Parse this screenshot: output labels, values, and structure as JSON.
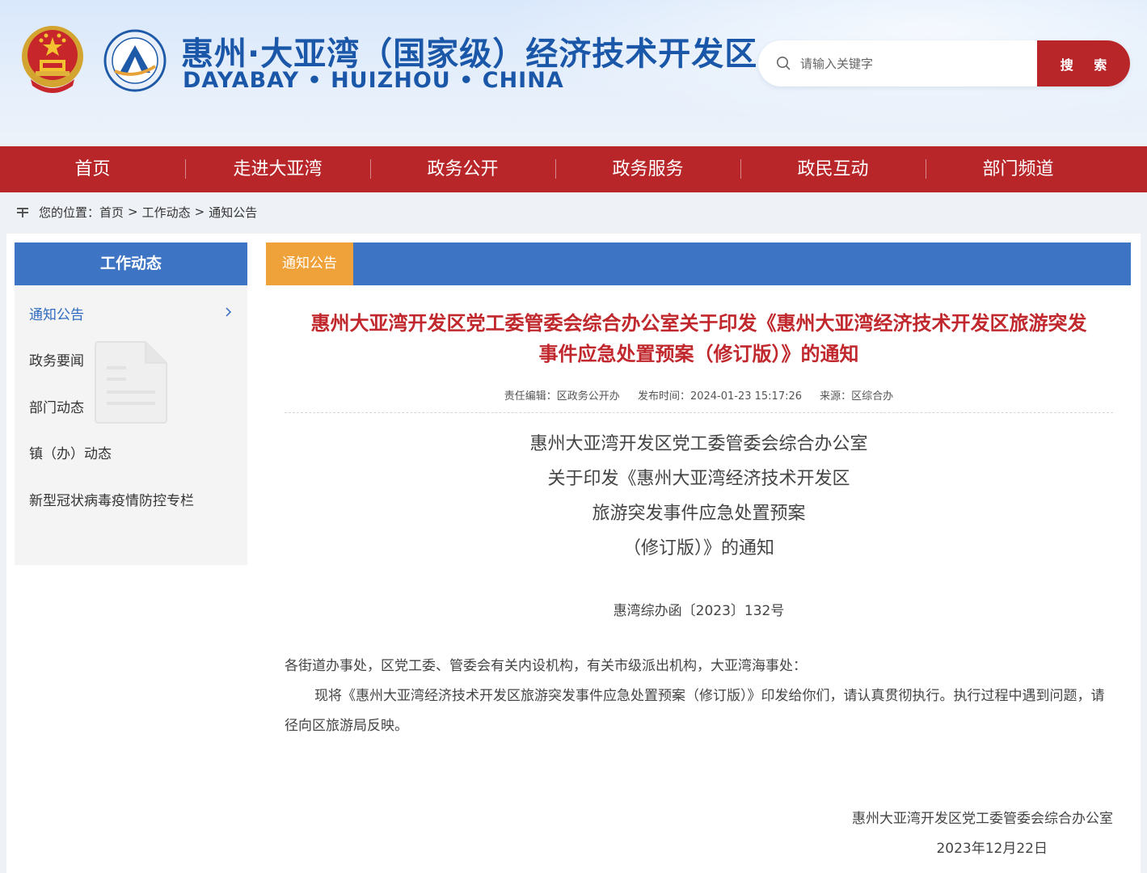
{
  "header": {
    "title_cn": "惠州·大亚湾（国家级）经济技术开发区",
    "title_en": "DAYABAY • HUIZHOU • CHINA",
    "search": {
      "placeholder": "请输入关键字",
      "button": "搜 索"
    }
  },
  "nav": [
    "首页",
    "走进大亚湾",
    "政务公开",
    "政务服务",
    "政民互动",
    "部门频道"
  ],
  "breadcrumb": {
    "prefix": "您的位置：",
    "items": [
      "首页",
      "工作动态",
      "通知公告"
    ],
    "separator": ">"
  },
  "sidebar": {
    "heading": "工作动态",
    "items": [
      "通知公告",
      "政务要闻",
      "部门动态",
      "镇（办）动态",
      "新型冠状病毒疫情防控专栏"
    ]
  },
  "content": {
    "tab": "通知公告",
    "title_line1": "惠州大亚湾开发区党工委管委会综合办公室关于印发《惠州大亚湾经济技术开发区旅游突发",
    "title_line2": "事件应急处置预案（修订版）》的通知",
    "meta": {
      "editor": "责任编辑：区政务公开办",
      "time": "发布时间：2024-01-23 15:17:26",
      "source": "来源：区综合办"
    },
    "doc_heading": [
      "惠州大亚湾开发区党工委管委会综合办公室",
      "关于印发《惠州大亚湾经济技术开发区",
      "旅游突发事件应急处置预案",
      "（修订版）》的通知"
    ],
    "doc_number": "惠湾综办函〔2023〕132号",
    "salutation": "各街道办事处，区党工委、管委会有关内设机构，有关市级派出机构，大亚湾海事处：",
    "paragraph": "现将《惠州大亚湾经济技术开发区旅游突发事件应急处置预案（修订版）》印发给你们，请认真贯彻执行。执行过程中遇到问题，请径向区旅游局反映。",
    "signature": "惠州大亚湾开发区党工委管委会综合办公室",
    "date": "2023年12月22日"
  },
  "colors": {
    "nav_red": "#b8262a",
    "title_blue": "#1b57a8",
    "bar_blue": "#3d74c4",
    "tab_orange": "#f0a23a",
    "article_red": "#c0282d"
  },
  "icons": [
    "national-emblem-icon",
    "dayabay-logo-icon",
    "search-icon",
    "breadcrumb-icon",
    "chevron-right-icon",
    "document-watermark-icon"
  ]
}
